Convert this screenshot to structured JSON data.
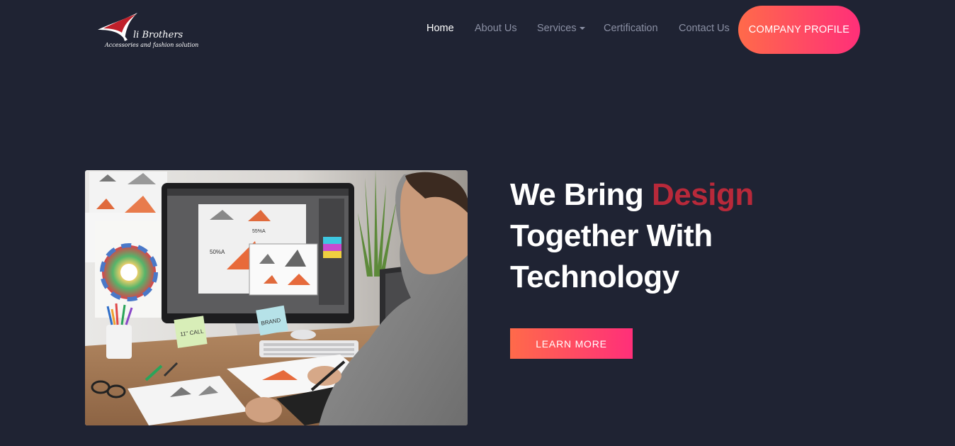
{
  "brand": {
    "name": "Ali Brothers",
    "name_display": "li Brothers",
    "tagline": "Accessories and fashion solution"
  },
  "nav": {
    "items": [
      {
        "label": "Home",
        "active": true
      },
      {
        "label": "About Us",
        "active": false
      },
      {
        "label": "Services",
        "active": false,
        "has_dropdown": true
      },
      {
        "label": "Certification",
        "active": false
      },
      {
        "label": "Contact Us",
        "active": false
      }
    ],
    "cta_label": "COMPANY PROFILE"
  },
  "hero": {
    "headline_part1": "We Bring ",
    "headline_accent": "Design",
    "headline_line2": "Together With",
    "headline_line3": "Technology",
    "button_label": "LEARN MORE",
    "image_label_1": "55%A",
    "image_label_2": "50%A",
    "sticky_note_1": "11\" CALL",
    "sticky_note_2": "BRAND"
  },
  "colors": {
    "background": "#1f2333",
    "accent_text": "#b8293a",
    "gradient_start": "#ff6a4a",
    "gradient_end": "#ff2f79",
    "nav_inactive": "#8a8fa3"
  }
}
